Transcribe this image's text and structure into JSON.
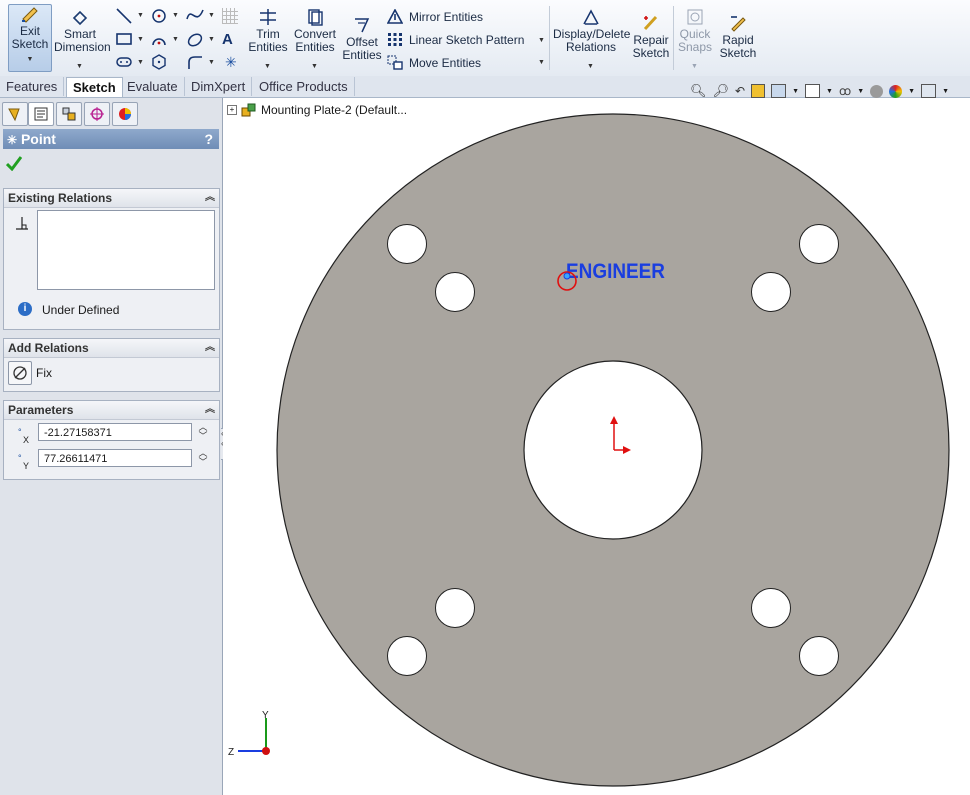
{
  "ribbon": {
    "exit_sketch": "Exit\nSketch",
    "smart_dimension": "Smart\nDimension",
    "trim_entities": "Trim\nEntities",
    "convert_entities": "Convert\nEntities",
    "offset_entities": "Offset\nEntities",
    "mirror_entities": "Mirror Entities",
    "linear_sketch_pattern": "Linear Sketch Pattern",
    "move_entities": "Move Entities",
    "display_delete_relations": "Display/Delete\nRelations",
    "repair_sketch": "Repair\nSketch",
    "quick_snaps": "Quick\nSnaps",
    "rapid_sketch": "Rapid\nSketch"
  },
  "tabs": [
    "Features",
    "Sketch",
    "Evaluate",
    "DimXpert",
    "Office Products"
  ],
  "active_tab": "Sketch",
  "property_manager": {
    "title": "Point",
    "help": "?",
    "existing_relations": {
      "header": "Existing Relations",
      "status": "Under Defined"
    },
    "add_relations": {
      "header": "Add Relations",
      "fix_label": "Fix"
    },
    "parameters": {
      "header": "Parameters",
      "x_value": "-21.27158371",
      "y_value": "77.26611471",
      "x_axis_label": "X",
      "y_axis_label": "Y"
    }
  },
  "viewport": {
    "tree_label": "Mounting Plate-2  (Default...",
    "annotation_text": "ENGINEER",
    "triad": {
      "y": "Y",
      "z": "Z"
    }
  },
  "colors": {
    "plate_fill": "#a9a59f",
    "annotation_blue": "#1a3ee0",
    "origin_red": "#e01010"
  }
}
